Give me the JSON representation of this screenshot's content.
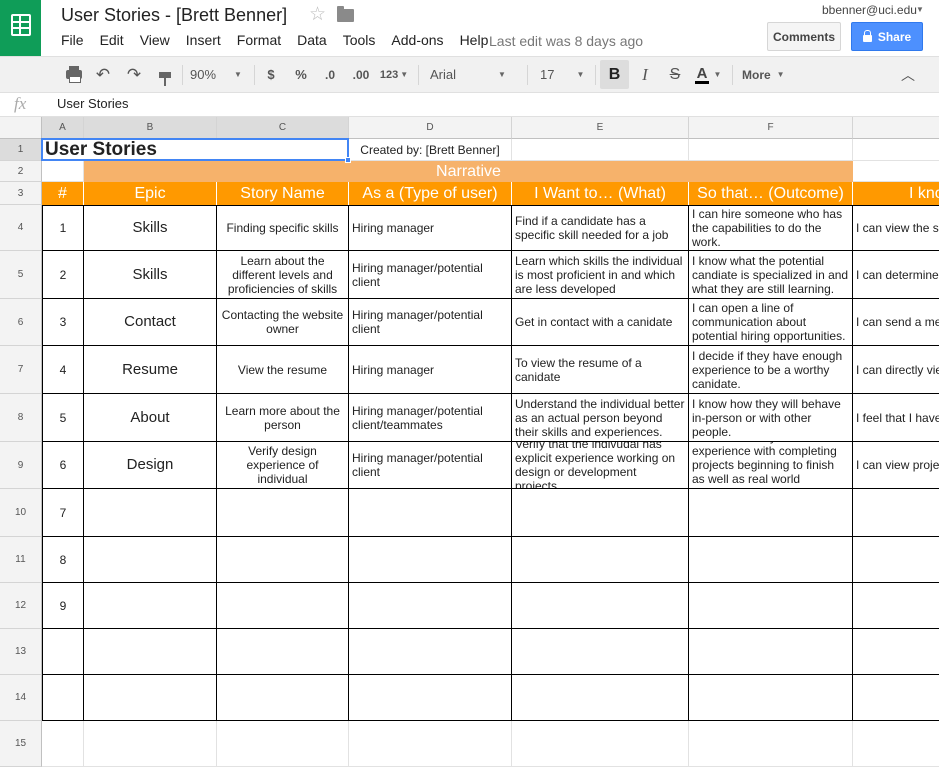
{
  "app": {
    "doc_title": "User Stories - [Brett Benner]",
    "account_email": "bbenner@uci.edu",
    "last_edit": "Last edit was 8 days ago",
    "comments_label": "Comments",
    "share_label": "Share",
    "menu": [
      "File",
      "Edit",
      "View",
      "Insert",
      "Format",
      "Data",
      "Tools",
      "Add-ons",
      "Help"
    ]
  },
  "toolbar": {
    "zoom": "90%",
    "currency": "$",
    "percent": "%",
    "decrease_decimal": ".0",
    "increase_decimal": ".00",
    "number_format": "123",
    "font_family": "Arial",
    "font_size": "17",
    "bold": "B",
    "italic": "I",
    "strikethrough": "S",
    "text_color": "A",
    "more": "More"
  },
  "formula": {
    "fx": "fx",
    "value": "User Stories"
  },
  "columns": [
    "A",
    "B",
    "C",
    "D",
    "E",
    "F"
  ],
  "rows": [
    "1",
    "2",
    "3",
    "4",
    "5",
    "6",
    "7",
    "8",
    "9",
    "10",
    "11",
    "12",
    "13",
    "14",
    "15"
  ],
  "sheet": {
    "title": "User Stories",
    "created_by": "Created by: [Brett Benner]",
    "narrative": "Narrative",
    "headers": [
      "#",
      "Epic",
      "Story Name",
      "As a (Type of user)",
      "I Want to… (What)",
      "So that… (Outcome)",
      "I kno"
    ],
    "stories": [
      [
        "1",
        "Skills",
        "Finding specific skills",
        "Hiring manager",
        "Find if a candidate has a specific skill needed for a job",
        "I can hire someone who has the capabilities to do the work.",
        "I can view the sk individual skill to"
      ],
      [
        "2",
        "Skills",
        "Learn about the different levels and proficiencies of skills",
        "Hiring manager/potential client",
        "Learn which skills the individual is most proficient in and which are less developed",
        "I know what the potential candiate is specialized in and what they are still learning.",
        "I can determine individuals skills"
      ],
      [
        "3",
        "Contact",
        "Contacting the website owner",
        "Hiring manager/potential client",
        "Get in contact with a canidate",
        "I can open a line of communication about potential hiring opportunities.",
        "I can send a me message was se"
      ],
      [
        "4",
        "Resume",
        "View the resume",
        "Hiring manager",
        "To view the resume of a canidate",
        "I decide if they have enough experience to be a worthy canidate.",
        "I can directly vie"
      ],
      [
        "5",
        "About",
        "Learn more about the person",
        "Hiring manager/potential client/teammates",
        "Understand the individual better as an actual person beyond their skills and experiences.",
        "I know how they will behave in-person or with other people.",
        "I feel that I have character and in"
      ],
      [
        "6",
        "Design",
        "Verify design experience of individual",
        "Hiring manager/potential client",
        "Verify that the indivudal has explicit experience working on design or development projects.",
        "I know that they have actual experience with completing projects beginning to finish as well as real world experience.",
        "I can view proje examples of pre"
      ],
      [
        "7",
        "",
        "",
        "",
        "",
        "",
        ""
      ],
      [
        "8",
        "",
        "",
        "",
        "",
        "",
        ""
      ],
      [
        "9",
        "",
        "",
        "",
        "",
        "",
        ""
      ],
      [
        "",
        "",
        "",
        "",
        "",
        "",
        ""
      ],
      [
        "",
        "",
        "",
        "",
        "",
        "",
        ""
      ]
    ]
  },
  "colors": {
    "brand_green": "#0f9d58",
    "header_orange": "#ff9900",
    "narrative_peach": "#f6b26b",
    "share_blue": "#4d90fe",
    "selection_blue": "#4285f4"
  }
}
